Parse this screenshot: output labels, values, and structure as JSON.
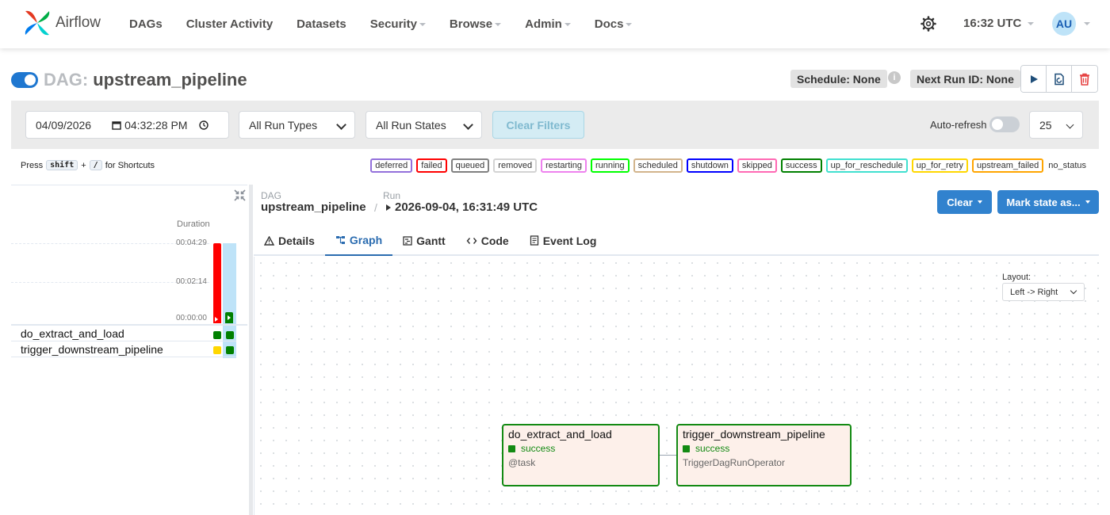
{
  "nav": {
    "brand": "Airflow",
    "items": [
      {
        "label": "DAGs",
        "dropdown": false
      },
      {
        "label": "Cluster Activity",
        "dropdown": false
      },
      {
        "label": "Datasets",
        "dropdown": false
      },
      {
        "label": "Security",
        "dropdown": true
      },
      {
        "label": "Browse",
        "dropdown": true
      },
      {
        "label": "Admin",
        "dropdown": true
      },
      {
        "label": "Docs",
        "dropdown": true
      }
    ],
    "clock": "16:32 UTC",
    "avatar": "AU"
  },
  "dag": {
    "label": "DAG:",
    "name": "upstream_pipeline",
    "schedule": "Schedule: None",
    "next_run": "Next Run ID: None",
    "info_icon": "i"
  },
  "filters": {
    "date": "04/09/2026",
    "time": "04:32:28 PM",
    "run_types": "All Run Types",
    "run_states": "All Run States",
    "clear": "Clear Filters",
    "autorefresh": "Auto-refresh",
    "limit": "25"
  },
  "shortcuts": {
    "press": "Press",
    "key1": "shift",
    "plus": "+",
    "key2": "/",
    "suffix": "for Shortcuts"
  },
  "legend": [
    {
      "label": "deferred",
      "color": "#9370db"
    },
    {
      "label": "failed",
      "color": "#ff0000"
    },
    {
      "label": "queued",
      "color": "#808080"
    },
    {
      "label": "removed",
      "color": "#d3d3d3"
    },
    {
      "label": "restarting",
      "color": "#ee82ee"
    },
    {
      "label": "running",
      "color": "#00ff00"
    },
    {
      "label": "scheduled",
      "color": "#d2b48c"
    },
    {
      "label": "shutdown",
      "color": "#0000ff"
    },
    {
      "label": "skipped",
      "color": "#ff69b4"
    },
    {
      "label": "success",
      "color": "#008000"
    },
    {
      "label": "up_for_reschedule",
      "color": "#40e0d0"
    },
    {
      "label": "up_for_retry",
      "color": "#ffd700"
    },
    {
      "label": "upstream_failed",
      "color": "#ffa500"
    }
  ],
  "legend_plain": "no_status",
  "grid": {
    "duration_label": "Duration",
    "ticks": [
      "00:04:29",
      "00:02:14",
      "00:00:00"
    ],
    "tasks": [
      {
        "name": "do_extract_and_load",
        "col1": "#008000",
        "col2": "#008000"
      },
      {
        "name": "trigger_downstream_pipeline",
        "col1": "#ffd700",
        "col2": "#008000"
      }
    ]
  },
  "breadcrumb": {
    "dag_label": "DAG",
    "dag_name": "upstream_pipeline",
    "sep": "/",
    "run_label": "Run",
    "run_id": "2026-09-04, 16:31:49 UTC"
  },
  "actions": {
    "clear": "Clear",
    "mark": "Mark state as..."
  },
  "tabs": [
    {
      "label": "Details",
      "icon": "warning-icon",
      "active": false
    },
    {
      "label": "Graph",
      "icon": "graph-icon",
      "active": true
    },
    {
      "label": "Gantt",
      "icon": "gantt-icon",
      "active": false
    },
    {
      "label": "Code",
      "icon": "code-icon",
      "active": false
    },
    {
      "label": "Event Log",
      "icon": "log-icon",
      "active": false
    }
  ],
  "graph": {
    "layout_label": "Layout:",
    "layout_value": "Left -> Right",
    "nodes": [
      {
        "title": "do_extract_and_load",
        "status": "success",
        "operator": "@task"
      },
      {
        "title": "trigger_downstream_pipeline",
        "status": "success",
        "operator": "TriggerDagRunOperator"
      }
    ]
  }
}
